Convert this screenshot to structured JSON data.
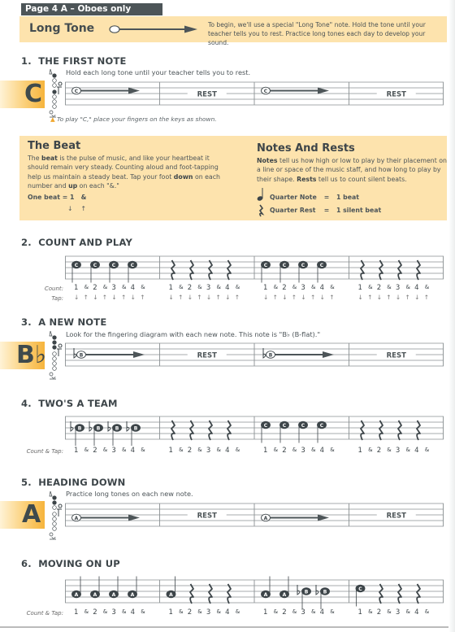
{
  "header": {
    "page_tab": "Page 4 A  –  Oboes only",
    "long_tone": {
      "title": "Long Tone",
      "description": "To begin, we'll use a special \"Long Tone\" note.  Hold the tone until your teacher tells you to rest.  Practice long tones each day to develop your sound."
    }
  },
  "colors": {
    "banner": "#fde3ad",
    "dark_text": "#3d4549",
    "tab_bg": "#4d5558",
    "note_tab_accent": "#f6b43c"
  },
  "exercises": [
    {
      "number": "1.",
      "title": "THE FIRST NOTE",
      "instruction": "Hold each long tone until your teacher tells you to rest.",
      "note_letter": "C",
      "measures": [
        {
          "type": "long-tone",
          "note": "C"
        },
        {
          "type": "rest",
          "label": "REST"
        },
        {
          "type": "long-tone",
          "note": "C"
        },
        {
          "type": "rest",
          "label": "REST"
        }
      ],
      "footnote": "To play \"C,\" place your fingers on the keys as shown."
    },
    {
      "number": "2.",
      "title": "COUNT AND PLAY",
      "count_label": "Count:",
      "tap_label": "Tap:",
      "measures": [
        {
          "type": "quarter-notes",
          "notes": [
            "C",
            "C",
            "C",
            "C"
          ]
        },
        {
          "type": "quarter-rests",
          "count": 4
        },
        {
          "type": "quarter-notes",
          "notes": [
            "C",
            "C",
            "C",
            "C"
          ]
        },
        {
          "type": "quarter-rests",
          "count": 4
        }
      ],
      "count": [
        "1",
        "&",
        "2",
        "&",
        "3",
        "&",
        "4",
        "&"
      ],
      "tap": [
        "↓",
        "↑",
        "↓",
        "↑",
        "↓",
        "↑",
        "↓",
        "↑"
      ]
    },
    {
      "number": "3.",
      "title": "A NEW NOTE",
      "instruction": "Look for the fingering diagram with each new note. This note is \"B♭ (B-flat).\"",
      "note_letter": "B♭",
      "measures": [
        {
          "type": "long-tone",
          "note": "B",
          "flat": true
        },
        {
          "type": "rest",
          "label": "REST"
        },
        {
          "type": "long-tone",
          "note": "B",
          "flat": true
        },
        {
          "type": "rest",
          "label": "REST"
        }
      ]
    },
    {
      "number": "4.",
      "title": "TWO'S A TEAM",
      "count_label": "Count & Tap:",
      "measures": [
        {
          "type": "quarter-notes",
          "notes": [
            "B♭",
            "B♭",
            "B♭",
            "B♭"
          ]
        },
        {
          "type": "quarter-rests",
          "count": 4
        },
        {
          "type": "quarter-notes",
          "notes": [
            "C",
            "C",
            "C",
            "C"
          ]
        },
        {
          "type": "quarter-rests",
          "count": 4
        }
      ],
      "count": [
        "1",
        "&",
        "2",
        "&",
        "3",
        "&",
        "4",
        "&"
      ]
    },
    {
      "number": "5.",
      "title": "HEADING DOWN",
      "instruction": "Practice long tones on each new note.",
      "note_letter": "A",
      "measures": [
        {
          "type": "long-tone",
          "note": "A"
        },
        {
          "type": "rest",
          "label": "REST"
        },
        {
          "type": "long-tone",
          "note": "A"
        },
        {
          "type": "rest",
          "label": "REST"
        }
      ]
    },
    {
      "number": "6.",
      "title": "MOVING ON UP",
      "count_label": "Count & Tap:",
      "measures": [
        {
          "type": "mixed",
          "items": [
            "A",
            "A",
            "A",
            "A"
          ]
        },
        {
          "type": "mixed",
          "items": [
            "A",
            "rest",
            "rest",
            "rest"
          ]
        },
        {
          "type": "mixed",
          "items": [
            "A",
            "A",
            "B♭",
            "B♭"
          ]
        },
        {
          "type": "mixed",
          "items": [
            "C",
            "rest",
            "rest",
            "rest"
          ]
        }
      ],
      "count": [
        "1",
        "&",
        "2",
        "&",
        "3",
        "&",
        "4",
        "&"
      ]
    }
  ],
  "the_beat": {
    "title": "The Beat",
    "text_parts": [
      {
        "t": "The ",
        "b": false
      },
      {
        "t": "beat",
        "b": true
      },
      {
        "t": " is the pulse of music, and like your heartbeat it should remain very steady.  Counting aloud and foot-tapping help us maintain a steady beat. Tap your foot ",
        "b": false
      },
      {
        "t": "down",
        "b": true
      },
      {
        "t": " on each number and ",
        "b": false
      },
      {
        "t": "up",
        "b": true
      },
      {
        "t": " on each \"&.\"",
        "b": false
      }
    ],
    "one_beat_label": "One beat  =  1",
    "one_beat_and": "&",
    "down_arrow": "↓",
    "up_arrow": "↑"
  },
  "notes_and_rests": {
    "title": "Notes And Rests",
    "text_parts": [
      {
        "t": "Notes",
        "b": true
      },
      {
        "t": " tell us how high or low to play by their placement on a line or space of the music staff, and how long to play by their shape.  ",
        "b": false
      },
      {
        "t": "Rests",
        "b": true
      },
      {
        "t": " tell us to count silent beats.",
        "b": false
      }
    ],
    "rows": [
      {
        "symbol": "quarter-note",
        "name": "Quarter Note",
        "eq": "=",
        "value": "1 beat"
      },
      {
        "symbol": "quarter-rest",
        "name": "Quarter Rest",
        "eq": "=",
        "value": "1 silent beat"
      }
    ]
  }
}
